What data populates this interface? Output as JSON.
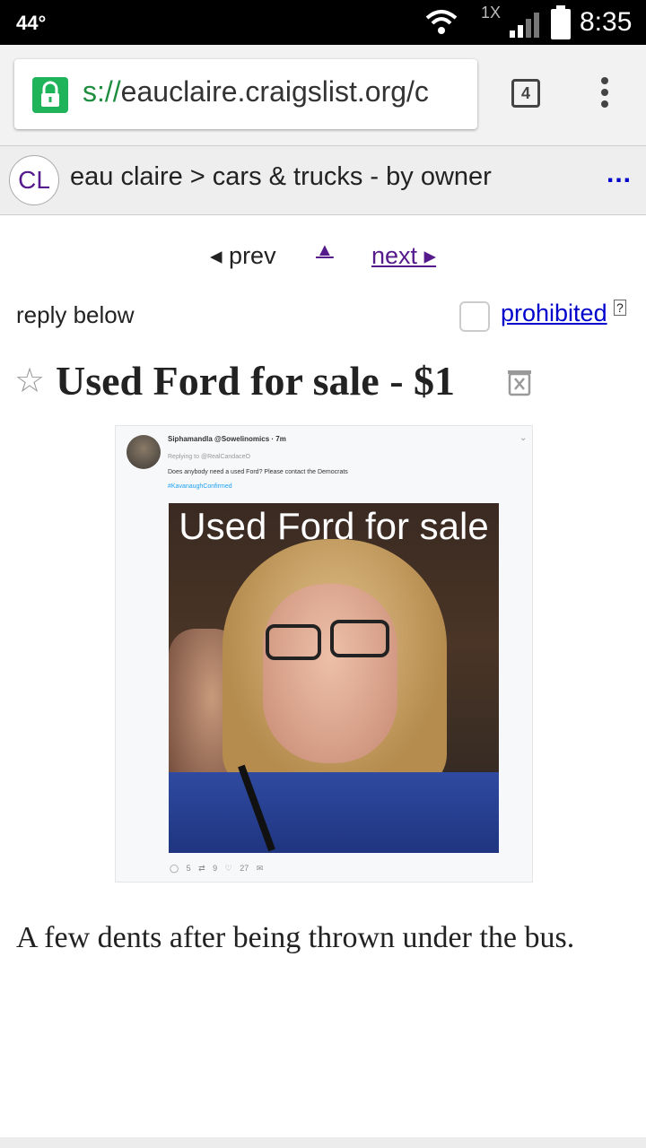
{
  "status_bar": {
    "temperature": "44°",
    "network_label": "1X",
    "time": "8:35"
  },
  "browser": {
    "url_scheme": "s://",
    "url_rest": "eauclaire.craigslist.org/c",
    "tab_count": "4"
  },
  "cl_header": {
    "logo": "CL",
    "breadcrumb": "eau claire > cars & trucks - by owner",
    "more": "..."
  },
  "nav": {
    "prev": "◂ prev",
    "up": "▲",
    "next": "next ▸"
  },
  "reply_row": {
    "reply_label": "reply below",
    "prohibited_label": "prohibited",
    "help_label": "?"
  },
  "posting": {
    "title": "Used Ford for sale - $1",
    "star_icon": "star-icon",
    "description": "A few dents after being thrown under the bus."
  },
  "image": {
    "tweet_name": "Siphamandla @Sowelinomics · 7m",
    "tweet_reply": "Replying to @RealCandaceO",
    "tweet_text": "Does anybody need a used Ford? Please contact the Democrats",
    "tweet_hashtag": "#KavanaughConfirmed",
    "caption": "Used Ford for sale",
    "actions": "◯ 5   ⇄ 9   ♡ 27   ✉"
  }
}
